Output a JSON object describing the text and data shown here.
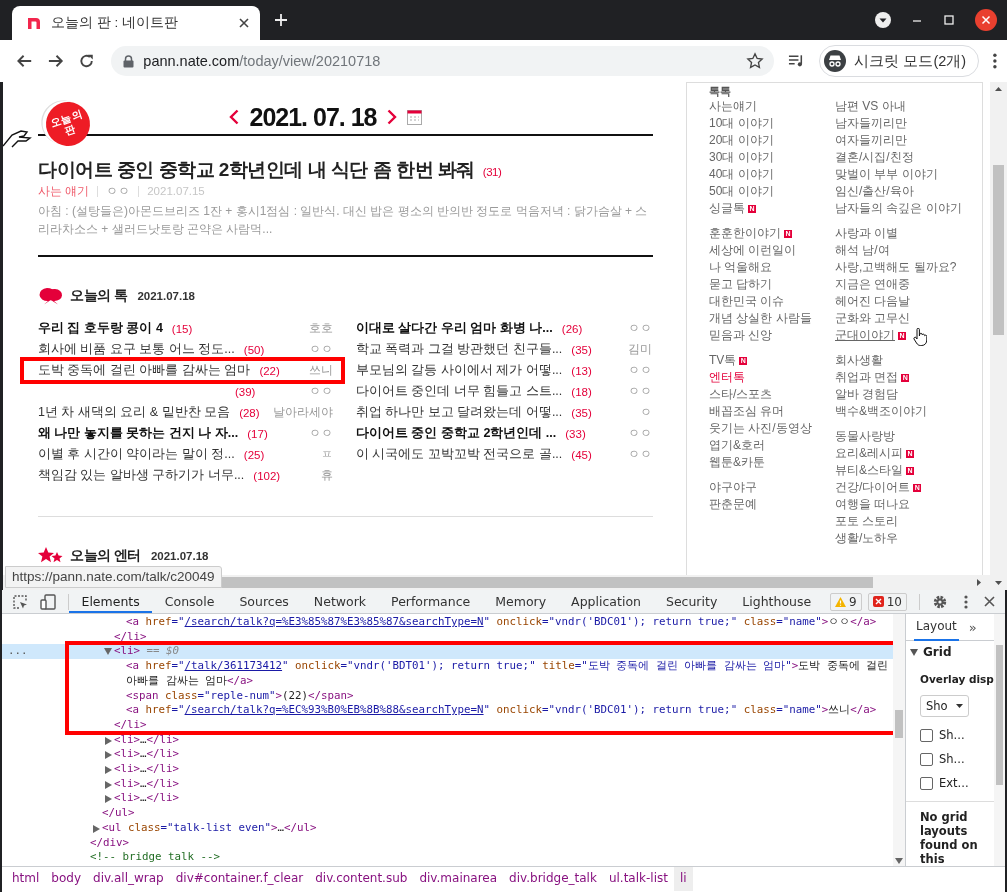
{
  "browser": {
    "tab": {
      "title": "오늘의 판 : 네이트판",
      "selected": true
    },
    "url_host": "pann.nate.com",
    "url_path": "/today/view/20210718",
    "profile": "시크릿 모드(2개)"
  },
  "page": {
    "logo": [
      "오늘의",
      "판"
    ],
    "date": "2021. 07. 18",
    "headline": {
      "title": "다이어트 중인 중학교 2학년인데 내 식단 좀 한번 봐줘",
      "count": "(31)",
      "category": "사는 얘기",
      "author": "ㅇㅇ",
      "date": "2021.07.15",
      "summary": "아침 : (설탕들은)아몬드브리즈 1잔 + 홍시1점심 : 일반식. 대신 밥은 평소의 반의반 정도로 먹음저녁 : 닭가슴살 + 스리라차소스 + 샐러드낫토랑 곤약은 사람먹..."
    },
    "talk": {
      "title": "오늘의 톡",
      "date": "2021.07.18",
      "columns": [
        [
          {
            "title": "우리 집 호두랑 콩이 4",
            "count": "(15)",
            "author": "호호",
            "bold": true,
            "annotated": false
          },
          {
            "title": "회사에 비품 요구 보통 어느 정도...",
            "count": "(50)",
            "author": "ㅇㅇ",
            "bold": false,
            "annotated": false
          },
          {
            "title": "도박 중독에 걸린 아빠를 감싸는 엄마",
            "count": "(22)",
            "author": "쓰니",
            "bold": false,
            "annotated": true
          },
          {
            "count": "(39)",
            "author": "ㅇㅇ",
            "annotated": false
          },
          {
            "title": "1년 차 새댁의 요리 & 밑반찬 모음",
            "count": "(28)",
            "author": "날아라세야",
            "bold": false,
            "annotated": false
          },
          {
            "title": "왜 나만 놓지를 못하는 건지 나 자...",
            "count": "(17)",
            "author": "ㅇㅇ",
            "bold": true,
            "annotated": false
          },
          {
            "title": "이별 후 시간이 약이라는 말이 정...",
            "count": "(25)",
            "author": "ㅍ",
            "bold": false,
            "annotated": false
          },
          {
            "title": "책임감 있는 알바생 구하기가 너무...",
            "count": "(102)",
            "author": "휴",
            "bold": false,
            "annotated": false
          }
        ],
        [
          {
            "title": "이대로 살다간 우리 엄마 화병 나...",
            "count": "(26)",
            "author": "ㅇㅇ",
            "bold": true,
            "annotated": false
          },
          {
            "title": "학교 폭력과 그걸 방관했던 친구들...",
            "count": "(35)",
            "author": "김미",
            "bold": false,
            "annotated": false
          },
          {
            "title": "부모님의 갈등 사이에서 제가 어떻...",
            "count": "(13)",
            "author": "ㅇㅇ",
            "bold": false,
            "annotated": false
          },
          {
            "title": "다이어트 중인데 너무 힘들고 스트...",
            "count": "(18)",
            "author": "ㅇㅇ",
            "bold": false,
            "annotated": false
          },
          {
            "title": "취업 하나만 보고 달려왔는데 어떻...",
            "count": "(35)",
            "author": "ㅇ",
            "bold": false,
            "annotated": false
          },
          {
            "title": "다이어트 중인 중학교 2학년인데 ...",
            "count": "(33)",
            "author": "ㅇㅇ",
            "bold": true,
            "annotated": false
          },
          {
            "title": "이 시국에도 꼬박꼬박 전국으로 골...",
            "count": "(45)",
            "author": "ㅇㅇ",
            "bold": false,
            "annotated": false
          }
        ]
      ]
    },
    "enter": {
      "title": "오늘의 엔터",
      "date": "2021.07.18"
    },
    "sidebar": {
      "heading": "톡톡",
      "columns": [
        [
          [
            {
              "label": "사는얘기",
              "selected": false,
              "hovered": false
            },
            {
              "label": "10대 이야기",
              "selected": false,
              "hovered": false
            },
            {
              "label": "20대 이야기",
              "selected": false,
              "hovered": false
            },
            {
              "label": "30대 이야기",
              "selected": false,
              "hovered": false
            },
            {
              "label": "40대 이야기",
              "selected": false,
              "hovered": false
            },
            {
              "label": "50대 이야기",
              "selected": false,
              "hovered": false
            },
            {
              "label": "싱글톡",
              "badge": "N",
              "selected": false,
              "hovered": false
            }
          ],
          [
            {
              "label": "훈훈한이야기",
              "badge": "N",
              "selected": false,
              "hovered": false
            },
            {
              "label": "세상에 이런일이",
              "selected": false,
              "hovered": false
            },
            {
              "label": "나 억울해요",
              "selected": false,
              "hovered": false
            },
            {
              "label": "묻고 답하기",
              "selected": false,
              "hovered": false
            },
            {
              "label": "대한민국 이슈",
              "selected": false,
              "hovered": false
            },
            {
              "label": "개념 상실한 사람들",
              "selected": false,
              "hovered": false
            },
            {
              "label": "믿음과 신앙",
              "selected": false,
              "hovered": false
            }
          ],
          [
            {
              "label": "TV톡",
              "badge": "N",
              "selected": false,
              "hovered": false
            },
            {
              "label": "엔터톡",
              "selected": true,
              "hovered": false
            },
            {
              "label": "스타/스포츠",
              "selected": false,
              "hovered": false
            },
            {
              "label": "배꼽조심 유머",
              "selected": false,
              "hovered": false
            },
            {
              "label": "웃기는 사진/동영상",
              "selected": false,
              "hovered": false
            },
            {
              "label": "엽기&호러",
              "selected": false,
              "hovered": false
            },
            {
              "label": "웹툰&카툰",
              "selected": false,
              "hovered": false
            }
          ],
          [
            {
              "label": "야구야구",
              "selected": false,
              "hovered": false
            },
            {
              "label": "판춘문예",
              "selected": false,
              "hovered": false
            }
          ]
        ],
        [
          [
            {
              "label": "남편 VS 아내",
              "selected": false,
              "hovered": false
            },
            {
              "label": "남자들끼리만",
              "selected": false,
              "hovered": false
            },
            {
              "label": "여자들끼리만",
              "selected": false,
              "hovered": false
            },
            {
              "label": "결혼/시집/친정",
              "selected": false,
              "hovered": false
            },
            {
              "label": "맞벌이 부부 이야기",
              "selected": false,
              "hovered": false
            },
            {
              "label": "임신/출산/육아",
              "selected": false,
              "hovered": false
            },
            {
              "label": "남자들의 속깊은 이야기",
              "selected": false,
              "hovered": false
            }
          ],
          [
            {
              "label": "사랑과 이별",
              "selected": false,
              "hovered": false
            },
            {
              "label": "해석 남/여",
              "selected": false,
              "hovered": false
            },
            {
              "label": "사랑,고백해도 될까요?",
              "selected": false,
              "hovered": false
            },
            {
              "label": "지금은 연애중",
              "selected": false,
              "hovered": false
            },
            {
              "label": "헤어진 다음날",
              "selected": false,
              "hovered": false
            },
            {
              "label": "군화와 고무신",
              "selected": false,
              "hovered": false
            },
            {
              "label": "군대이야기",
              "badge": "N",
              "selected": false,
              "hovered": true
            }
          ],
          [
            {
              "label": "회사생활",
              "selected": false,
              "hovered": false
            },
            {
              "label": "취업과 면접",
              "badge": "N",
              "selected": false,
              "hovered": false
            },
            {
              "label": "알바 경험담",
              "selected": false,
              "hovered": false
            },
            {
              "label": "백수&백조이야기",
              "selected": false,
              "hovered": false
            }
          ],
          [
            {
              "label": "동물사랑방",
              "selected": false,
              "hovered": false
            },
            {
              "label": "요리&레시피",
              "badge": "N",
              "selected": false,
              "hovered": false
            },
            {
              "label": "뷰티&스타일",
              "badge": "N",
              "selected": false,
              "hovered": false
            },
            {
              "label": "건강/다이어트",
              "badge": "N",
              "selected": false,
              "hovered": false
            },
            {
              "label": "여행을 떠나요",
              "selected": false,
              "hovered": false
            },
            {
              "label": "포토 스토리",
              "selected": false,
              "hovered": false
            },
            {
              "label": "생활/노하우",
              "selected": false,
              "hovered": false
            }
          ]
        ]
      ]
    },
    "status_url": "https://pann.nate.com/talk/c20049"
  },
  "devtools": {
    "tabs": [
      {
        "label": "Elements",
        "selected": true
      },
      {
        "label": "Console",
        "selected": false
      },
      {
        "label": "Sources",
        "selected": false
      },
      {
        "label": "Network",
        "selected": false
      },
      {
        "label": "Performance",
        "selected": false
      },
      {
        "label": "Memory",
        "selected": false
      },
      {
        "label": "Application",
        "selected": false
      },
      {
        "label": "Security",
        "selected": false
      },
      {
        "label": "Lighthouse",
        "selected": false
      }
    ],
    "warnings": "9",
    "errors": "10",
    "tree": [
      {
        "children": [
          {
            "children": [
              {
                "children": [
                  {
                    "selected": false,
                    "annotated": false,
                    "open": [
                      {
                        "kind": "tag",
                        "text": "<a"
                      },
                      {
                        "kind": "an",
                        "text": " href"
                      },
                      {
                        "kind": "q",
                        "text": "=\""
                      },
                      {
                        "kind": "link",
                        "text": "/search/talk?q=%E3%85%87%E3%85%87&searchType=N"
                      },
                      {
                        "kind": "q",
                        "text": "\""
                      },
                      {
                        "kind": "an",
                        "text": " onclick"
                      },
                      {
                        "kind": "q",
                        "text": "=\""
                      },
                      {
                        "kind": "av",
                        "text": "vndr('BDC01'); return true;"
                      },
                      {
                        "kind": "q",
                        "text": "\""
                      },
                      {
                        "kind": "an",
                        "text": " class"
                      },
                      {
                        "kind": "q",
                        "text": "=\""
                      },
                      {
                        "kind": "av",
                        "text": "name"
                      },
                      {
                        "kind": "q",
                        "text": "\""
                      },
                      {
                        "kind": "tag",
                        "text": ">"
                      },
                      {
                        "kind": "tx",
                        "text": "ㅇㅇ"
                      },
                      {
                        "kind": "tag",
                        "text": "</a>"
                      }
                    ]
                  }
                ],
                "close": [
                  {
                    "kind": "tag",
                    "text": "</li>"
                  }
                ]
              },
              {
                "selected": true,
                "annotated": true,
                "expanded": true,
                "gutter": "...",
                "open": [
                  {
                    "kind": "tag",
                    "text": "<li>"
                  },
                  {
                    "kind": "ref",
                    "text": " == $0"
                  }
                ],
                "children": [
                  {
                    "selected": false,
                    "annotated": false,
                    "open": [
                      {
                        "kind": "tag",
                        "text": "<a"
                      },
                      {
                        "kind": "an",
                        "text": " href"
                      },
                      {
                        "kind": "q",
                        "text": "=\""
                      },
                      {
                        "kind": "link",
                        "text": "/talk/361173412"
                      },
                      {
                        "kind": "q",
                        "text": "\""
                      },
                      {
                        "kind": "an",
                        "text": " onclick"
                      },
                      {
                        "kind": "q",
                        "text": "=\""
                      },
                      {
                        "kind": "av",
                        "text": "vndr('BDT01'); return true;"
                      },
                      {
                        "kind": "q",
                        "text": "\""
                      },
                      {
                        "kind": "an",
                        "text": " title"
                      },
                      {
                        "kind": "q",
                        "text": "=\""
                      },
                      {
                        "kind": "av",
                        "text": "도박 중독에 걸린 아빠를 감싸는 엄마"
                      },
                      {
                        "kind": "q",
                        "text": "\""
                      },
                      {
                        "kind": "tag",
                        "text": ">"
                      },
                      {
                        "kind": "tx",
                        "text": "도박 중독에 걸린 아빠를 감싸는 엄마"
                      },
                      {
                        "kind": "tag",
                        "text": "</a>"
                      }
                    ]
                  },
                  {
                    "selected": false,
                    "annotated": false,
                    "open": [
                      {
                        "kind": "tag",
                        "text": "<span"
                      },
                      {
                        "kind": "an",
                        "text": " class"
                      },
                      {
                        "kind": "q",
                        "text": "=\""
                      },
                      {
                        "kind": "av",
                        "text": "reple-num"
                      },
                      {
                        "kind": "q",
                        "text": "\""
                      },
                      {
                        "kind": "tag",
                        "text": ">"
                      },
                      {
                        "kind": "tx",
                        "text": "(22)"
                      },
                      {
                        "kind": "tag",
                        "text": "</span>"
                      }
                    ]
                  },
                  {
                    "selected": false,
                    "annotated": false,
                    "open": [
                      {
                        "kind": "tag",
                        "text": "<a"
                      },
                      {
                        "kind": "an",
                        "text": " href"
                      },
                      {
                        "kind": "q",
                        "text": "=\""
                      },
                      {
                        "kind": "link",
                        "text": "/search/talk?q=%EC%93%B0%EB%8B%88&searchType=N"
                      },
                      {
                        "kind": "q",
                        "text": "\""
                      },
                      {
                        "kind": "an",
                        "text": " onclick"
                      },
                      {
                        "kind": "q",
                        "text": "=\""
                      },
                      {
                        "kind": "av",
                        "text": "vndr('BDC01'); return true;"
                      },
                      {
                        "kind": "q",
                        "text": "\""
                      },
                      {
                        "kind": "an",
                        "text": " class"
                      },
                      {
                        "kind": "q",
                        "text": "=\""
                      },
                      {
                        "kind": "av",
                        "text": "name"
                      },
                      {
                        "kind": "q",
                        "text": "\""
                      },
                      {
                        "kind": "tag",
                        "text": ">"
                      },
                      {
                        "kind": "tx",
                        "text": "쓰니"
                      },
                      {
                        "kind": "tag",
                        "text": "</a>"
                      }
                    ]
                  }
                ],
                "close": [
                  {
                    "kind": "tag",
                    "text": "</li>"
                  }
                ]
              },
              {
                "selected": false,
                "annotated": false,
                "expanded": false,
                "open": [
                  {
                    "kind": "tag",
                    "text": "<li>"
                  },
                  {
                    "kind": "tx",
                    "text": "…"
                  },
                  {
                    "kind": "tag",
                    "text": "</li>"
                  }
                ]
              },
              {
                "selected": false,
                "annotated": false,
                "expanded": false,
                "open": [
                  {
                    "kind": "tag",
                    "text": "<li>"
                  },
                  {
                    "kind": "tx",
                    "text": "…"
                  },
                  {
                    "kind": "tag",
                    "text": "</li>"
                  }
                ]
              },
              {
                "selected": false,
                "annotated": false,
                "expanded": false,
                "open": [
                  {
                    "kind": "tag",
                    "text": "<li>"
                  },
                  {
                    "kind": "tx",
                    "text": "…"
                  },
                  {
                    "kind": "tag",
                    "text": "</li>"
                  }
                ]
              },
              {
                "selected": false,
                "annotated": false,
                "expanded": false,
                "open": [
                  {
                    "kind": "tag",
                    "text": "<li>"
                  },
                  {
                    "kind": "tx",
                    "text": "…"
                  },
                  {
                    "kind": "tag",
                    "text": "</li>"
                  }
                ]
              },
              {
                "selected": false,
                "annotated": false,
                "expanded": false,
                "open": [
                  {
                    "kind": "tag",
                    "text": "<li>"
                  },
                  {
                    "kind": "tx",
                    "text": "…"
                  },
                  {
                    "kind": "tag",
                    "text": "</li>"
                  }
                ]
              }
            ],
            "close": [
              {
                "kind": "tag",
                "text": "</ul>"
              }
            ]
          },
          {
            "selected": false,
            "annotated": false,
            "expanded": false,
            "open": [
              {
                "kind": "tag",
                "text": "<ul"
              },
              {
                "kind": "an",
                "text": " class"
              },
              {
                "kind": "q",
                "text": "=\""
              },
              {
                "kind": "av",
                "text": "talk-list even"
              },
              {
                "kind": "q",
                "text": "\""
              },
              {
                "kind": "tag",
                "text": ">"
              },
              {
                "kind": "tx",
                "text": "…"
              },
              {
                "kind": "tag",
                "text": "</ul>"
              }
            ]
          }
        ],
        "close": [
          {
            "kind": "tag",
            "text": "</div>"
          }
        ]
      },
      {
        "selected": false,
        "annotated": false,
        "open": [
          {
            "kind": "cm",
            "text": "<!-- bridge talk -->"
          }
        ]
      }
    ],
    "side_tabs": [
      {
        "label": "Layout",
        "selected": true
      }
    ],
    "more_tabs": "»",
    "grid": {
      "title": "Grid",
      "expanded": true,
      "overlay": "Overlay disp",
      "select": "Sho",
      "checks": [
        {
          "label": "Sh...",
          "checked": false
        },
        {
          "label": "Sh...",
          "checked": false
        },
        {
          "label": "Ext...",
          "checked": false
        }
      ],
      "empty": "No grid layouts found on this"
    },
    "breadcrumbs": [
      {
        "label": "html",
        "selected": false
      },
      {
        "label": "body",
        "selected": false
      },
      {
        "label": "div.all_wrap",
        "selected": false
      },
      {
        "label": "div#container.f_clear",
        "selected": false
      },
      {
        "label": "div.content.sub",
        "selected": false
      },
      {
        "label": "div.mainarea",
        "selected": false
      },
      {
        "label": "div.bridge_talk",
        "selected": false
      },
      {
        "label": "ul.talk-list",
        "selected": false
      },
      {
        "label": "li",
        "selected": true
      }
    ]
  }
}
